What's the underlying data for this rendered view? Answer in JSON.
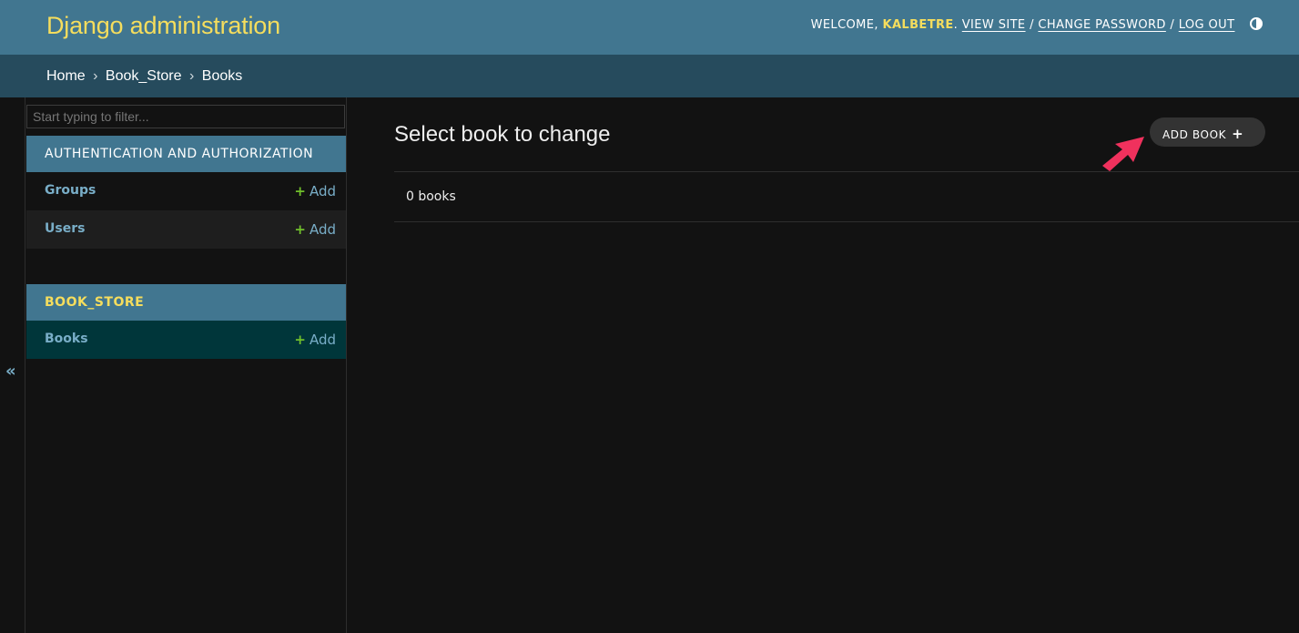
{
  "header": {
    "brand": "Django administration",
    "welcome_text": "WELCOME,",
    "username": "KALBETRE",
    "period": ".",
    "view_site": "VIEW SITE",
    "separator": "/",
    "change_password": "CHANGE PASSWORD",
    "log_out": "LOG OUT",
    "theme_icon": "theme-toggle-icon"
  },
  "breadcrumbs": {
    "home": "Home",
    "app": "Book_Store",
    "current": "Books",
    "separator": "›"
  },
  "sidebar": {
    "filter_placeholder": "Start typing to filter...",
    "toggle_label": "«",
    "modules": [
      {
        "caption": "AUTHENTICATION AND AUTHORIZATION",
        "models": [
          {
            "name": "Groups",
            "add": "Add"
          },
          {
            "name": "Users",
            "add": "Add"
          }
        ]
      },
      {
        "caption": "BOOK_STORE",
        "models": [
          {
            "name": "Books",
            "add": "Add"
          }
        ]
      }
    ],
    "add_symbol": "+"
  },
  "content": {
    "title": "Select book to change",
    "add_button": "ADD BOOK",
    "add_button_symbol": "+",
    "result_count": "0 books"
  },
  "colors": {
    "header_bg": "#417690",
    "brand": "#f5dd5d",
    "breadcrumb_bg": "#264b5d",
    "link": "#79aec8",
    "add_plus": "#70bf2b",
    "active_row": "#00363a",
    "annotation_arrow": "#f0315d"
  }
}
